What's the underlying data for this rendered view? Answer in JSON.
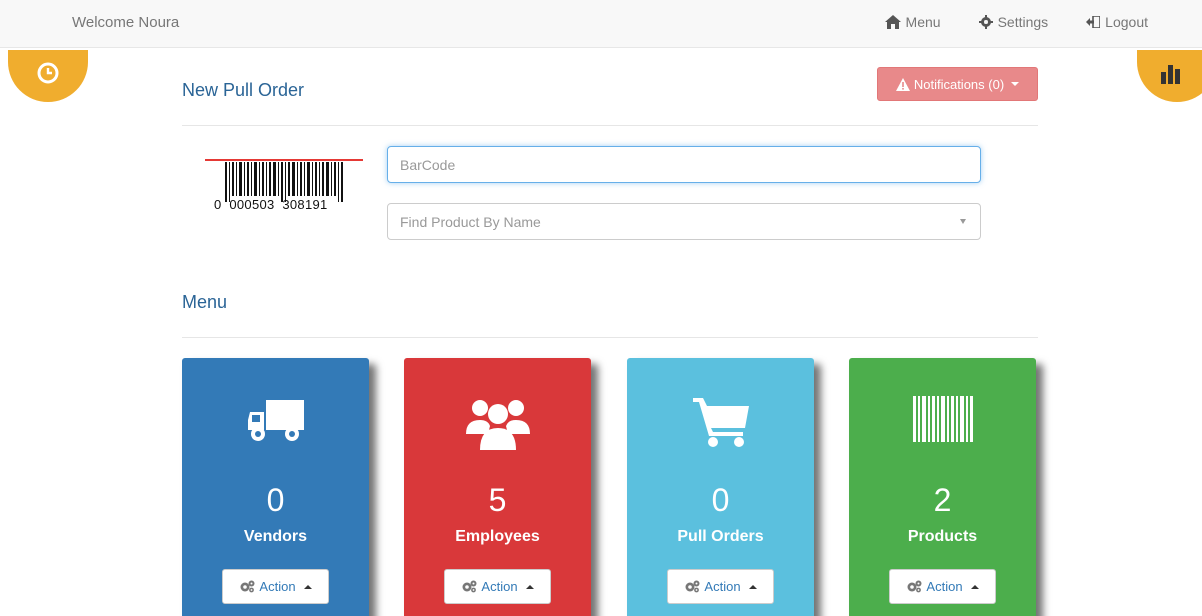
{
  "navbar": {
    "welcome": "Welcome Noura",
    "links": [
      {
        "label": "Menu",
        "icon": "home-icon"
      },
      {
        "label": "Settings",
        "icon": "gear-icon"
      },
      {
        "label": "Logout",
        "icon": "logout-icon"
      }
    ]
  },
  "corner_buttons": {
    "left_icon": "clock-icon",
    "right_icon": "bar-chart-icon",
    "color": "#f0ad2e"
  },
  "pull_order": {
    "title": "New Pull Order",
    "notifications_label": "Notifications (0)",
    "barcode_number": "0  000503  308191",
    "barcode_placeholder": "BarCode",
    "product_placeholder": "Find Product By Name"
  },
  "menu": {
    "title": "Menu",
    "tiles": [
      {
        "count": "0",
        "label": "Vendors",
        "icon": "truck-icon",
        "color": "#337ab7",
        "action": "Action"
      },
      {
        "count": "5",
        "label": "Employees",
        "icon": "users-icon",
        "color": "#d9383a",
        "action": "Action"
      },
      {
        "count": "0",
        "label": "Pull Orders",
        "icon": "cart-icon",
        "color": "#5bc0de",
        "action": "Action"
      },
      {
        "count": "2",
        "label": "Products",
        "icon": "barcode-icon",
        "color": "#4cae4c",
        "action": "Action"
      }
    ]
  }
}
